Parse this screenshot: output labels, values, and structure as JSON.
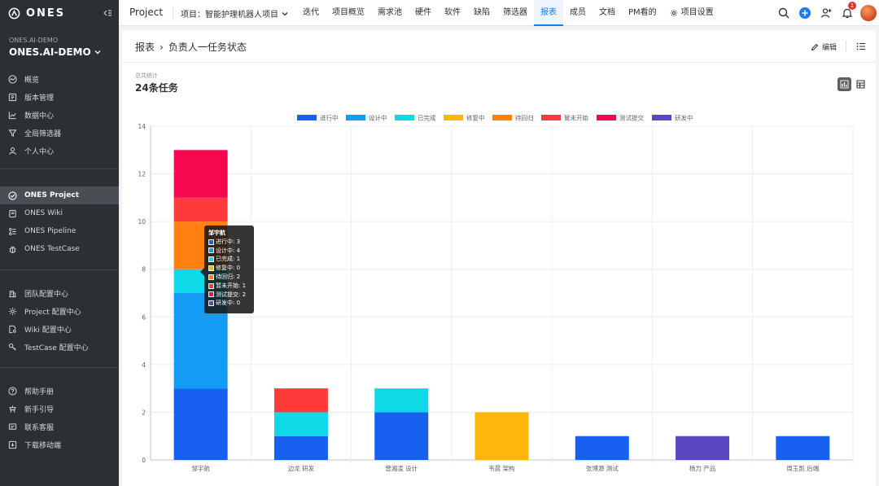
{
  "sidebar": {
    "logo_text": "ONES",
    "org_small": "ONES.AI-DEMO",
    "org_name": "ONES.AI-DEMO",
    "main_items": [
      {
        "label": "概览",
        "icon": "dashboard-icon"
      },
      {
        "label": "版本管理",
        "icon": "version-icon"
      },
      {
        "label": "数据中心",
        "icon": "chart-line-icon"
      },
      {
        "label": "全局筛选器",
        "icon": "filter-icon"
      },
      {
        "label": "个人中心",
        "icon": "user-icon"
      }
    ],
    "product_items": [
      {
        "label": "ONES Project",
        "icon": "check-circle-icon",
        "active": true
      },
      {
        "label": "ONES Wiki",
        "icon": "book-icon"
      },
      {
        "label": "ONES Pipeline",
        "icon": "pipeline-icon"
      },
      {
        "label": "ONES TestCase",
        "icon": "bug-icon"
      }
    ],
    "config_items": [
      {
        "label": "团队配置中心",
        "icon": "building-icon"
      },
      {
        "label": "Project 配置中心",
        "icon": "gear-icon"
      },
      {
        "label": "Wiki 配置中心",
        "icon": "doc-gear-icon"
      },
      {
        "label": "TestCase 配置中心",
        "icon": "key-icon"
      }
    ],
    "help_items": [
      {
        "label": "帮助手册",
        "icon": "help-icon"
      },
      {
        "label": "新手引导",
        "icon": "guide-icon"
      },
      {
        "label": "联系客服",
        "icon": "message-icon"
      },
      {
        "label": "下载移动端",
        "icon": "download-icon"
      }
    ]
  },
  "topbar": {
    "title": "Project",
    "project": "项目：智能护理机器人项目",
    "tabs": [
      {
        "label": "迭代"
      },
      {
        "label": "项目概览"
      },
      {
        "label": "需求池"
      },
      {
        "label": "硬件"
      },
      {
        "label": "软件"
      },
      {
        "label": "缺陷"
      },
      {
        "label": "筛选器"
      },
      {
        "label": "报表",
        "active": true
      },
      {
        "label": "成员"
      },
      {
        "label": "文档"
      },
      {
        "label": "PM看的"
      },
      {
        "label": "项目设置",
        "icon": "gear-icon"
      }
    ],
    "notification_count": "1"
  },
  "header": {
    "crumb_root": "报表",
    "crumb_separator": "›",
    "crumb_current": "负责人一任务状态",
    "edit_label": "编辑"
  },
  "summary": {
    "label": "总共统计",
    "value": "24条任务"
  },
  "chart_data": {
    "type": "bar",
    "stacked": true,
    "categories": [
      "邹宇航",
      "边龙 研发",
      "曾湘凌 设计",
      "韦晨 架构",
      "张博源 测试",
      "杨力 产品",
      "周玉凯 后端"
    ],
    "ylim": [
      0,
      14
    ],
    "yticks": [
      0,
      2,
      4,
      6,
      8,
      10,
      12,
      14
    ],
    "grid": true,
    "legend_position": "top-center",
    "series": [
      {
        "name": "进行中",
        "color": "#1760f0",
        "values": [
          3,
          1,
          2,
          0,
          1,
          0,
          1
        ]
      },
      {
        "name": "设计中",
        "color": "#149cf5",
        "values": [
          4,
          0,
          0,
          0,
          0,
          0,
          0
        ]
      },
      {
        "name": "已完成",
        "color": "#0fd9e6",
        "values": [
          1,
          1,
          1,
          0,
          0,
          0,
          0
        ]
      },
      {
        "name": "修复中",
        "color": "#ffb60a",
        "values": [
          0,
          0,
          0,
          2,
          0,
          0,
          0
        ]
      },
      {
        "name": "待回归",
        "color": "#ff7f11",
        "values": [
          2,
          0,
          0,
          0,
          0,
          0,
          0
        ]
      },
      {
        "name": "暂未开始",
        "color": "#ff3a3a",
        "values": [
          1,
          1,
          0,
          0,
          0,
          0,
          0
        ]
      },
      {
        "name": "测试提交",
        "color": "#f5084f",
        "values": [
          2,
          0,
          0,
          0,
          0,
          0,
          0
        ]
      },
      {
        "name": "研发中",
        "color": "#5a47c2",
        "values": [
          0,
          0,
          0,
          0,
          0,
          1,
          0
        ]
      }
    ]
  },
  "tooltip": {
    "title": "邹宇航",
    "rows": [
      "进行中: 3",
      "设计中: 4",
      "已完成: 1",
      "修复中: 0",
      "待回归: 2",
      "暂未开始: 1",
      "测试提交: 2",
      "研发中: 0"
    ]
  }
}
